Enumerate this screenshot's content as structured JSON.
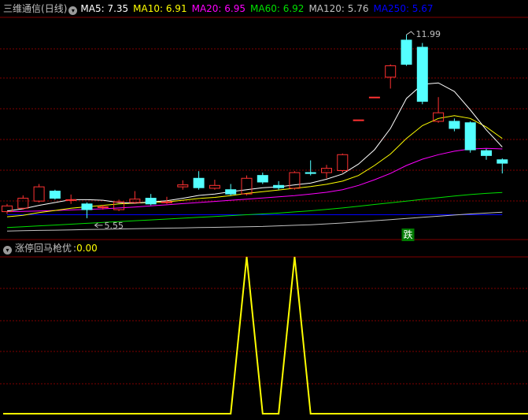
{
  "main_panel": {
    "title": "三维通信",
    "period": "(日线)",
    "ma": [
      {
        "label": "MA5",
        "value": "7.35",
        "color": "#ffffff"
      },
      {
        "label": "MA10",
        "value": "6.91",
        "color": "#ffff00"
      },
      {
        "label": "MA20",
        "value": "6.95",
        "color": "#ff00ff"
      },
      {
        "label": "MA60",
        "value": "6.92",
        "color": "#00e000"
      },
      {
        "label": "MA120",
        "value": "5.76",
        "color": "#c0c0c0"
      },
      {
        "label": "MA250",
        "value": "5.67",
        "color": "#0000ff"
      }
    ],
    "high_annotation": "11.99",
    "low_annotation": "5.55",
    "signal_text": "跌",
    "colors": {
      "up": "#ff3232",
      "down": "#54ffff",
      "grid": "#7f0000",
      "background": "#000000"
    }
  },
  "sub_panel": {
    "title": "涨停回马枪优",
    "value": "0.00",
    "line_color": "#ffff00"
  },
  "chart_data": [
    {
      "type": "candlestick",
      "title": "三维通信 (日线)",
      "candles": [
        {
          "o": 5.78,
          "c": 5.98,
          "h": 6.05,
          "l": 5.7
        },
        {
          "o": 5.9,
          "c": 6.25,
          "h": 6.35,
          "l": 5.85
        },
        {
          "o": 6.15,
          "c": 6.65,
          "h": 6.75,
          "l": 6.1
        },
        {
          "o": 6.5,
          "c": 6.25,
          "h": 6.55,
          "l": 6.2
        },
        {
          "o": 6.2,
          "c": 6.2,
          "h": 6.38,
          "l": 6.05
        },
        {
          "o": 6.05,
          "c": 5.85,
          "h": 6.1,
          "l": 5.55
        },
        {
          "o": 5.95,
          "c": 5.95,
          "h": 6.02,
          "l": 5.85
        },
        {
          "o": 5.85,
          "c": 6.12,
          "h": 6.2,
          "l": 5.8
        },
        {
          "o": 6.1,
          "c": 6.22,
          "h": 6.5,
          "l": 6.05
        },
        {
          "o": 6.25,
          "c": 6.05,
          "h": 6.4,
          "l": 6.0
        },
        {
          "o": 6.1,
          "c": 6.12,
          "h": 6.3,
          "l": 6.05
        },
        {
          "o": 6.65,
          "c": 6.72,
          "h": 6.88,
          "l": 6.55
        },
        {
          "o": 6.95,
          "c": 6.62,
          "h": 7.2,
          "l": 6.55
        },
        {
          "o": 6.6,
          "c": 6.7,
          "h": 6.9,
          "l": 6.55
        },
        {
          "o": 6.55,
          "c": 6.4,
          "h": 6.75,
          "l": 6.35
        },
        {
          "o": 6.4,
          "c": 6.95,
          "h": 7.05,
          "l": 6.35
        },
        {
          "o": 7.05,
          "c": 6.82,
          "h": 7.15,
          "l": 6.75
        },
        {
          "o": 6.7,
          "c": 6.62,
          "h": 6.85,
          "l": 6.55
        },
        {
          "o": 6.6,
          "c": 7.15,
          "h": 7.2,
          "l": 6.55
        },
        {
          "o": 7.15,
          "c": 7.12,
          "h": 7.58,
          "l": 7.05
        },
        {
          "o": 7.15,
          "c": 7.3,
          "h": 7.42,
          "l": 6.95
        },
        {
          "o": 7.22,
          "c": 7.78,
          "h": 7.82,
          "l": 7.15
        },
        {
          "o": 9.0,
          "c": 9.0,
          "h": 9.0,
          "l": 9.0
        },
        {
          "o": 9.8,
          "c": 9.8,
          "h": 9.8,
          "l": 9.8
        },
        {
          "o": 10.5,
          "c": 10.9,
          "h": 10.95,
          "l": 10.1
        },
        {
          "o": 11.8,
          "c": 10.95,
          "h": 11.99,
          "l": 10.9
        },
        {
          "o": 11.55,
          "c": 9.65,
          "h": 11.7,
          "l": 9.55
        },
        {
          "o": 8.95,
          "c": 9.25,
          "h": 9.8,
          "l": 8.9
        },
        {
          "o": 8.95,
          "c": 8.7,
          "h": 9.05,
          "l": 8.6
        },
        {
          "o": 8.9,
          "c": 7.95,
          "h": 8.95,
          "l": 7.85
        },
        {
          "o": 7.92,
          "c": 7.75,
          "h": 7.98,
          "l": 7.6
        },
        {
          "o": 7.6,
          "c": 7.48,
          "h": 7.65,
          "l": 7.12
        }
      ],
      "moving_averages": {
        "MA5": [
          5.8,
          5.88,
          6.0,
          6.1,
          6.2,
          6.2,
          6.18,
          6.1,
          6.08,
          6.12,
          6.16,
          6.25,
          6.35,
          6.4,
          6.48,
          6.55,
          6.62,
          6.65,
          6.72,
          6.78,
          6.92,
          7.1,
          7.45,
          7.95,
          8.7,
          9.75,
          10.25,
          10.3,
          10.0,
          9.35,
          8.65,
          8.05
        ],
        "MA10": [
          5.6,
          5.65,
          5.75,
          5.82,
          5.9,
          5.95,
          6.0,
          6.05,
          6.08,
          6.1,
          6.12,
          6.18,
          6.24,
          6.28,
          6.34,
          6.42,
          6.48,
          6.54,
          6.6,
          6.66,
          6.74,
          6.85,
          7.05,
          7.4,
          7.8,
          8.35,
          8.8,
          9.05,
          9.15,
          9.05,
          8.75,
          8.35
        ],
        "MA20": [
          5.78,
          5.79,
          5.8,
          5.82,
          5.84,
          5.86,
          5.88,
          5.91,
          5.94,
          5.98,
          6.02,
          6.06,
          6.1,
          6.14,
          6.18,
          6.22,
          6.26,
          6.3,
          6.34,
          6.4,
          6.46,
          6.55,
          6.7,
          6.9,
          7.12,
          7.4,
          7.62,
          7.78,
          7.9,
          7.98,
          8.0,
          7.98
        ],
        "MA60": [
          5.22,
          5.25,
          5.28,
          5.31,
          5.34,
          5.37,
          5.4,
          5.43,
          5.46,
          5.49,
          5.52,
          5.55,
          5.58,
          5.61,
          5.64,
          5.67,
          5.7,
          5.73,
          5.77,
          5.81,
          5.86,
          5.91,
          5.97,
          6.03,
          6.09,
          6.15,
          6.21,
          6.27,
          6.33,
          6.38,
          6.42,
          6.45
        ],
        "MA120": [
          5.1,
          5.11,
          5.12,
          5.13,
          5.14,
          5.15,
          5.16,
          5.17,
          5.18,
          5.19,
          5.2,
          5.21,
          5.22,
          5.23,
          5.24,
          5.25,
          5.26,
          5.28,
          5.3,
          5.32,
          5.35,
          5.38,
          5.42,
          5.46,
          5.5,
          5.54,
          5.58,
          5.62,
          5.66,
          5.7,
          5.73,
          5.76
        ],
        "MA250": [
          5.67,
          5.67,
          5.67,
          5.67,
          5.67,
          5.67,
          5.67,
          5.67,
          5.67,
          5.67,
          5.67,
          5.67,
          5.67,
          5.67,
          5.67,
          5.67,
          5.67,
          5.67,
          5.67,
          5.67,
          5.67,
          5.67,
          5.67,
          5.67,
          5.67,
          5.67,
          5.67,
          5.67,
          5.67,
          5.67,
          5.67,
          5.67
        ]
      },
      "ylim": [
        4.8,
        12.6
      ]
    },
    {
      "type": "line",
      "title": "涨停回马枪优",
      "values": [
        0,
        0,
        0,
        0,
        0,
        0,
        0,
        0,
        0,
        0,
        0,
        0,
        0,
        0,
        0,
        1,
        0,
        0,
        1,
        0,
        0,
        0,
        0,
        0,
        0,
        0,
        0,
        0,
        0,
        0,
        0,
        0
      ],
      "ylim": [
        0,
        1
      ]
    }
  ]
}
